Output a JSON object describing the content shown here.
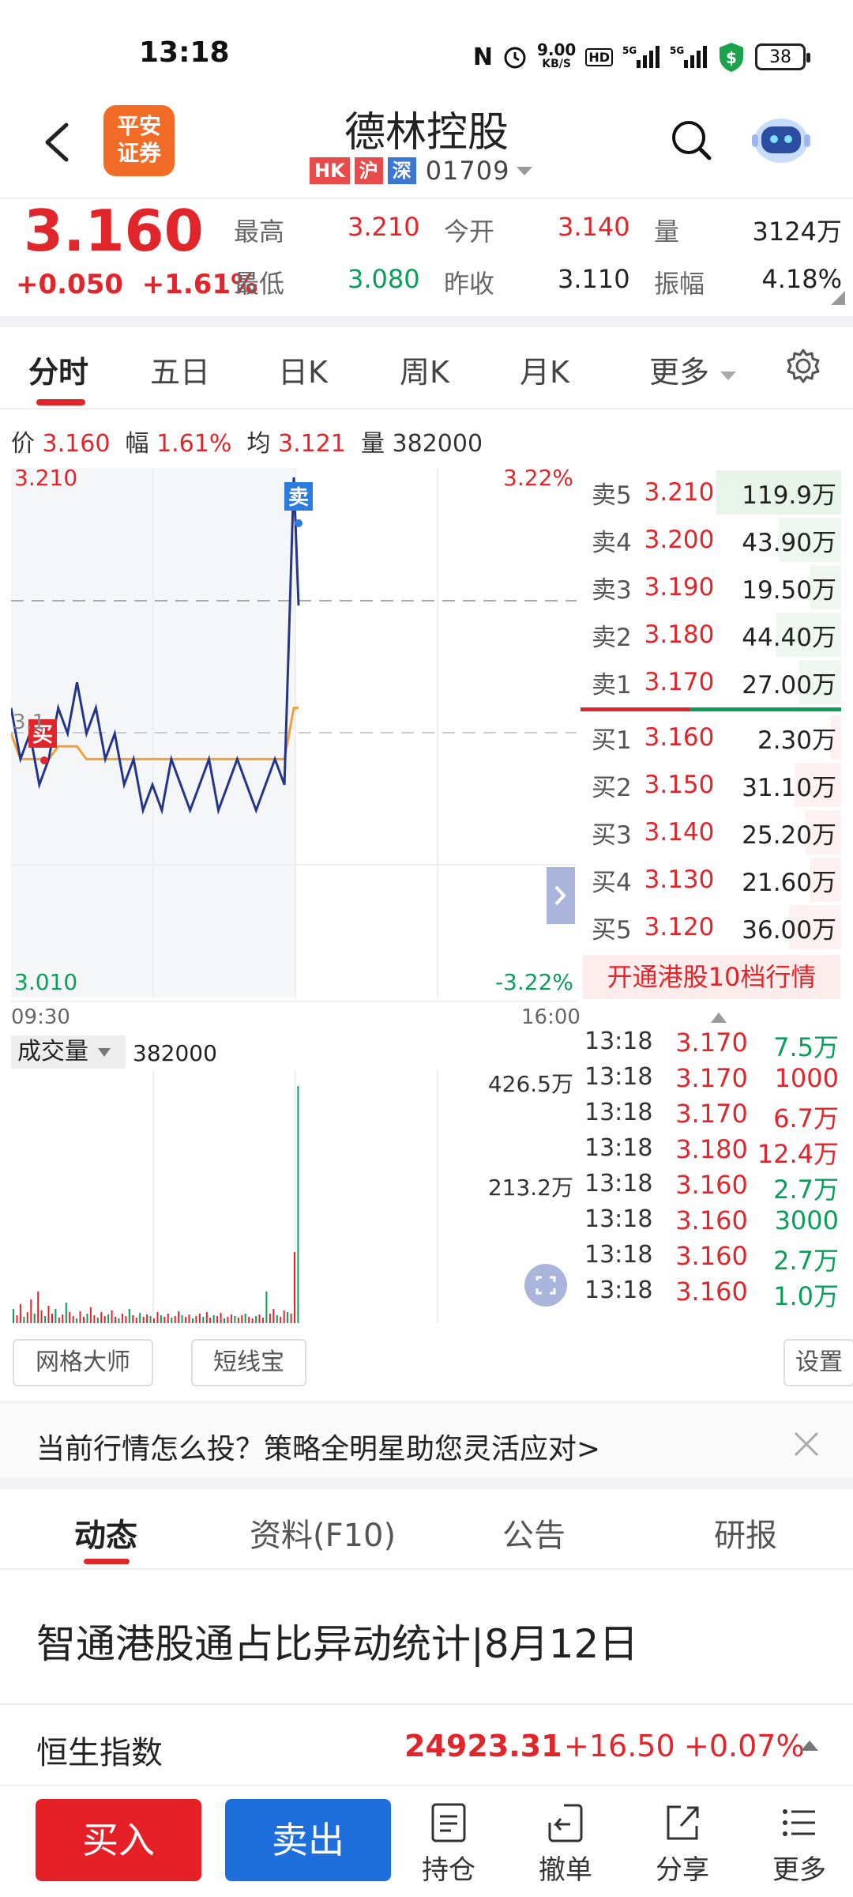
{
  "status": {
    "time": "13:18",
    "net_speed": "9.00",
    "net_unit": "KB/S",
    "battery": "38"
  },
  "header": {
    "stock_name": "德林控股",
    "logo_text_1": "平安",
    "logo_text_2": "证券",
    "tags": [
      "HK",
      "沪",
      "深"
    ],
    "code": "01709"
  },
  "quote": {
    "price": "3.160",
    "change": "+0.050",
    "change_pct": "+1.61%",
    "high_label": "最高",
    "high": "3.210",
    "low_label": "最低",
    "low": "3.080",
    "open_label": "今开",
    "open": "3.140",
    "prev_label": "昨收",
    "prev": "3.110",
    "vol_label": "量",
    "vol": "3124万",
    "amp_label": "振幅",
    "amp": "4.18%"
  },
  "tabs": [
    "分时",
    "五日",
    "日K",
    "周K",
    "月K",
    "更多"
  ],
  "info": {
    "price_label": "价",
    "price": "3.160",
    "pct_label": "幅",
    "pct": "1.61%",
    "avg_label": "均",
    "avg": "3.121",
    "vol_label": "量",
    "vol": "382000"
  },
  "chart": {
    "top_left": "3.210",
    "top_right": "3.22%",
    "bottom_left": "3.010",
    "bottom_right": "-3.22%",
    "mid_label": "3.1",
    "time_start": "09:30",
    "time_end": "16:00",
    "sell_marker": "卖",
    "buy_marker": "买",
    "vol_label": "成交量",
    "vol_value": "382000",
    "vol_top": "426.5万",
    "vol_mid": "213.2万"
  },
  "chart_data": {
    "type": "line",
    "series": [
      {
        "values": [
          3.12,
          3.1,
          3.11,
          3.09,
          3.1,
          3.12,
          3.11,
          3.13,
          3.11,
          3.12,
          3.1,
          3.11,
          3.09,
          3.1,
          3.08,
          3.09,
          3.08,
          3.1,
          3.09,
          3.08,
          3.09,
          3.1,
          3.08,
          3.09,
          3.1,
          3.09,
          3.08,
          3.09,
          3.1,
          3.09,
          3.21,
          3.16
        ]
      },
      {
        "values": [
          3.11,
          3.1,
          3.1,
          3.1,
          3.1,
          3.105,
          3.105,
          3.105,
          3.1,
          3.1,
          3.1,
          3.1,
          3.1,
          3.1,
          3.1,
          3.1,
          3.1,
          3.1,
          3.1,
          3.1,
          3.1,
          3.1,
          3.1,
          3.1,
          3.1,
          3.1,
          3.1,
          3.1,
          3.1,
          3.1,
          3.12,
          3.12
        ]
      }
    ],
    "ylim": [
      3.01,
      3.21
    ]
  },
  "orderbook": {
    "asks": [
      {
        "label": "卖5",
        "price": "3.210",
        "vol": "119.9万"
      },
      {
        "label": "卖4",
        "price": "3.200",
        "vol": "43.90万"
      },
      {
        "label": "卖3",
        "price": "3.190",
        "vol": "19.50万"
      },
      {
        "label": "卖2",
        "price": "3.180",
        "vol": "44.40万"
      },
      {
        "label": "卖1",
        "price": "3.170",
        "vol": "27.00万"
      }
    ],
    "bids": [
      {
        "label": "买1",
        "price": "3.160",
        "vol": "2.30万"
      },
      {
        "label": "买2",
        "price": "3.150",
        "vol": "31.10万"
      },
      {
        "label": "买3",
        "price": "3.140",
        "vol": "25.20万"
      },
      {
        "label": "买4",
        "price": "3.130",
        "vol": "21.60万"
      },
      {
        "label": "买5",
        "price": "3.120",
        "vol": "36.00万"
      }
    ],
    "hk10": "开通港股10档行情"
  },
  "trades": [
    {
      "t": "13:18",
      "p": "3.170",
      "v": "7.5万"
    },
    {
      "t": "13:18",
      "p": "3.170",
      "v": "1000"
    },
    {
      "t": "13:18",
      "p": "3.170",
      "v": "6.7万"
    },
    {
      "t": "13:18",
      "p": "3.180",
      "v": "12.4万"
    },
    {
      "t": "13:18",
      "p": "3.160",
      "v": "2.7万"
    },
    {
      "t": "13:18",
      "p": "3.160",
      "v": "3000"
    },
    {
      "t": "13:18",
      "p": "3.160",
      "v": "2.7万"
    },
    {
      "t": "13:18",
      "p": "3.160",
      "v": "1.0万"
    }
  ],
  "tools": {
    "grid": "网格大师",
    "short": "短线宝",
    "settings": "设置"
  },
  "banner": {
    "text": "当前行情怎么投？策略全明星助您灵活应对>"
  },
  "bottom_tabs": [
    "动态",
    "资料(F10)",
    "公告",
    "研报"
  ],
  "news": {
    "title": "智通港股通占比异动统计|8月12日"
  },
  "index": {
    "name": "恒生指数",
    "value": "24923.31",
    "change": "+16.50",
    "pct": "+0.07%"
  },
  "actions": {
    "buy": "买入",
    "sell": "卖出",
    "position": "持仓",
    "cancel": "撤单",
    "share": "分享",
    "more": "更多"
  }
}
